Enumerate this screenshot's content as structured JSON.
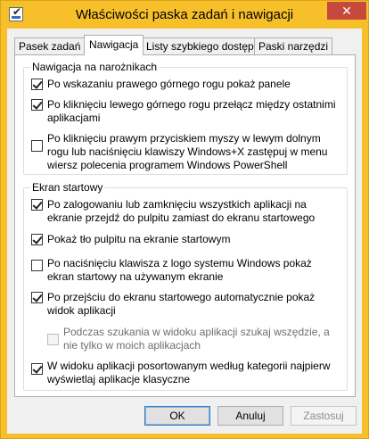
{
  "window": {
    "title": "Właściwości paska zadań i nawigacji",
    "close_glyph": "✕"
  },
  "tabs": [
    {
      "label": "Pasek zadań",
      "active": false
    },
    {
      "label": "Nawigacja",
      "active": true
    },
    {
      "label": "Listy szybkiego dostępu",
      "active": false
    },
    {
      "label": "Paski narzędzi",
      "active": false
    }
  ],
  "groups": {
    "corners": {
      "title": "Nawigacja na narożnikach",
      "options": [
        {
          "label": "Po wskazaniu prawego górnego rogu pokaż panele",
          "checked": true
        },
        {
          "label": "Po kliknięciu lewego górnego rogu przełącz między ostatnimi aplikacjami",
          "checked": true
        },
        {
          "label": "Po kliknięciu prawym przyciskiem myszy w lewym dolnym rogu lub naciśnięciu klawiszy Windows+X zastępuj w menu wiersz polecenia programem Windows PowerShell",
          "checked": false
        }
      ]
    },
    "start": {
      "title": "Ekran startowy",
      "options": [
        {
          "label": "Po zalogowaniu lub zamknięciu wszystkich aplikacji na ekranie przejdź do pulpitu zamiast do ekranu startowego",
          "checked": true
        },
        {
          "label": "Pokaż tło pulpitu na ekranie startowym",
          "checked": true
        },
        {
          "label": "Po naciśnięciu klawisza z logo systemu Windows pokaż ekran startowy na używanym ekranie",
          "checked": false
        },
        {
          "label": "Po przejściu do ekranu startowego automatycznie pokaż widok aplikacji",
          "checked": true
        },
        {
          "label": "Podczas szukania w widoku aplikacji szukaj wszędzie, a nie tylko w moich aplikacjach",
          "checked": false,
          "disabled": true
        },
        {
          "label": "W widoku aplikacji posortowanym według kategorii najpierw wyświetlaj aplikacje klasyczne",
          "checked": true
        }
      ]
    }
  },
  "buttons": {
    "ok": "OK",
    "cancel": "Anuluj",
    "apply": "Zastosuj"
  }
}
